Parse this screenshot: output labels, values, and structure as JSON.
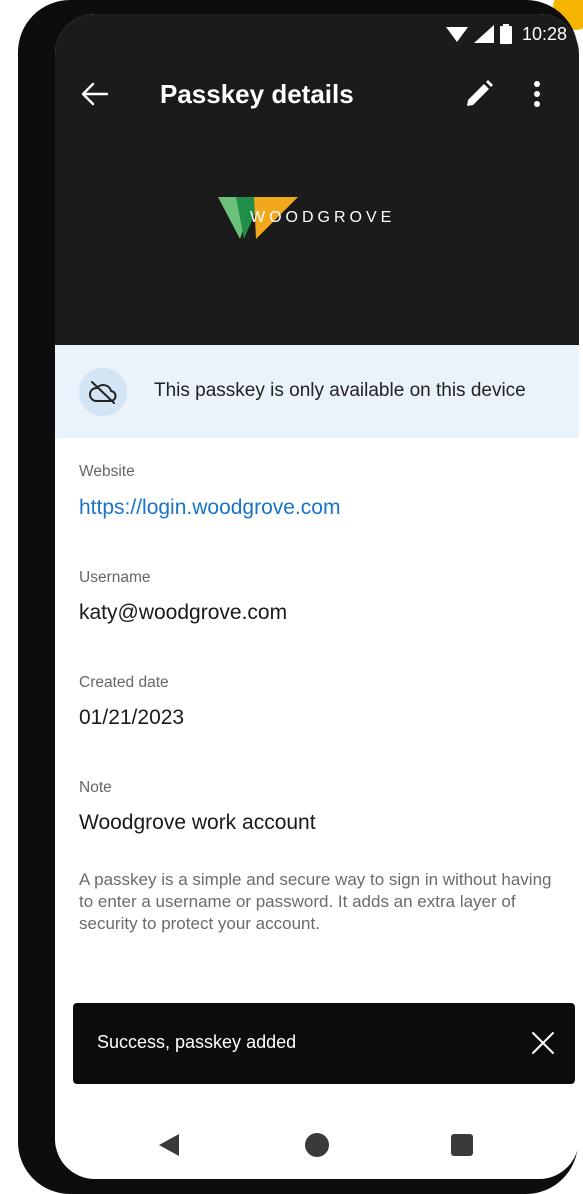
{
  "status_bar": {
    "time": "10:28",
    "icons": [
      "wifi-icon",
      "signal-icon",
      "battery-icon"
    ]
  },
  "app_bar": {
    "title": "Passkey details",
    "back_icon": "arrow-left-icon",
    "edit_icon": "pencil-icon",
    "more_icon": "more-vertical-icon"
  },
  "logo": {
    "text": "WOODGROVE",
    "colors": [
      "#6cc07a",
      "#1f8f4a",
      "#f2a81d"
    ]
  },
  "banner": {
    "icon": "cloud-off-icon",
    "text": "This passkey is only available on this device"
  },
  "fields": {
    "website": {
      "label": "Website",
      "value": "https://login.woodgrove.com"
    },
    "username": {
      "label": "Username",
      "value": "katy@woodgrove.com"
    },
    "created": {
      "label": "Created date",
      "value": "01/21/2023"
    },
    "note": {
      "label": "Note",
      "value": "Woodgrove work account"
    }
  },
  "info_text": "A passkey is a simple and secure way to sign in without having to enter a username or password. It adds an extra layer of security to protect your account.",
  "snackbar": {
    "text": "Success, passkey added",
    "close_icon": "close-icon"
  },
  "nav_bar": {
    "icons": [
      "nav-back-icon",
      "nav-home-icon",
      "nav-recents-icon"
    ]
  },
  "colors": {
    "accent": "#1a73c9",
    "header_bg": "#1b1b1b",
    "banner_bg": "#eaf3fb",
    "corner": "#f5b400"
  }
}
